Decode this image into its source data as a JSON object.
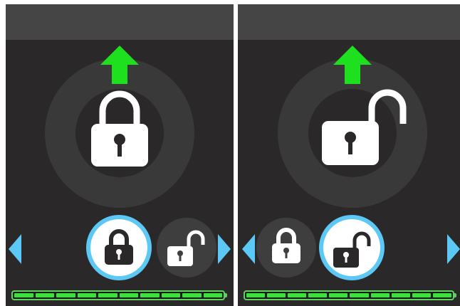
{
  "colors": {
    "screen_bg": "#2a2828",
    "top_bar": "#454545",
    "ring": "#3a3939",
    "arrow_green": "#1ee01e",
    "selection_blue": "#5bc8f5",
    "nav_arrow_blue": "#5bc8f5",
    "battery_green": "#3be23b"
  },
  "screens": [
    {
      "big_icon": "locked-padlock-icon",
      "selected_option": "lock",
      "options": [
        "lock",
        "unlock"
      ],
      "battery_level": 1.0
    },
    {
      "big_icon": "unlocked-padlock-icon",
      "selected_option": "unlock",
      "options": [
        "lock",
        "unlock"
      ],
      "battery_level": 1.0
    }
  ]
}
